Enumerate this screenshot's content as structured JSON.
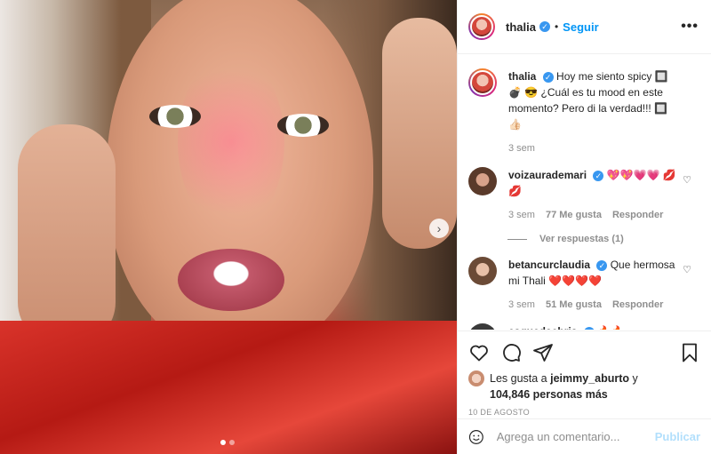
{
  "post": {
    "username": "thalia",
    "follow_label": "Seguir",
    "separator": "•",
    "more_label": "•••"
  },
  "caption": {
    "username": "thalia",
    "text": "Hoy me siento spicy 🔲💣 😎 ¿Cuál es tu mood en este momento? Pero di la verdad!!! 🔲👍🏻",
    "time": "3 sem"
  },
  "comments": [
    {
      "username": "voizaurademari",
      "text": "💖💖💗💗 💋💋",
      "time": "3 sem",
      "likes": "77 Me gusta",
      "reply": "Responder"
    },
    {
      "username": "betancurclaudia",
      "text": "Que hermosa mi Thali ❤️❤️❤️❤️",
      "time": "3 sem",
      "likes": "51 Me gusta",
      "reply": "Responder"
    },
    {
      "username": "esquedachris",
      "text": "🔥🔥"
    }
  ],
  "view_replies": "Ver respuestas (1)",
  "likes": {
    "prefix": "Les gusta a",
    "user": "jeimmy_aburto",
    "connector": "y",
    "count": "104,846 personas más"
  },
  "date": "10 DE AGOSTO",
  "add_comment": {
    "placeholder": "Agrega un comentario...",
    "publish": "Publicar"
  },
  "colors": {
    "link": "#0095f6",
    "verified": "#3897f0",
    "publish_disabled": "#b2dffc"
  },
  "icons": [
    "verified-badge-icon",
    "more-options-icon",
    "heart-icon",
    "comment-icon",
    "share-icon",
    "save-icon",
    "emoji-icon",
    "chevron-right-icon"
  ],
  "carousel": {
    "slides": 2,
    "active": 1
  }
}
